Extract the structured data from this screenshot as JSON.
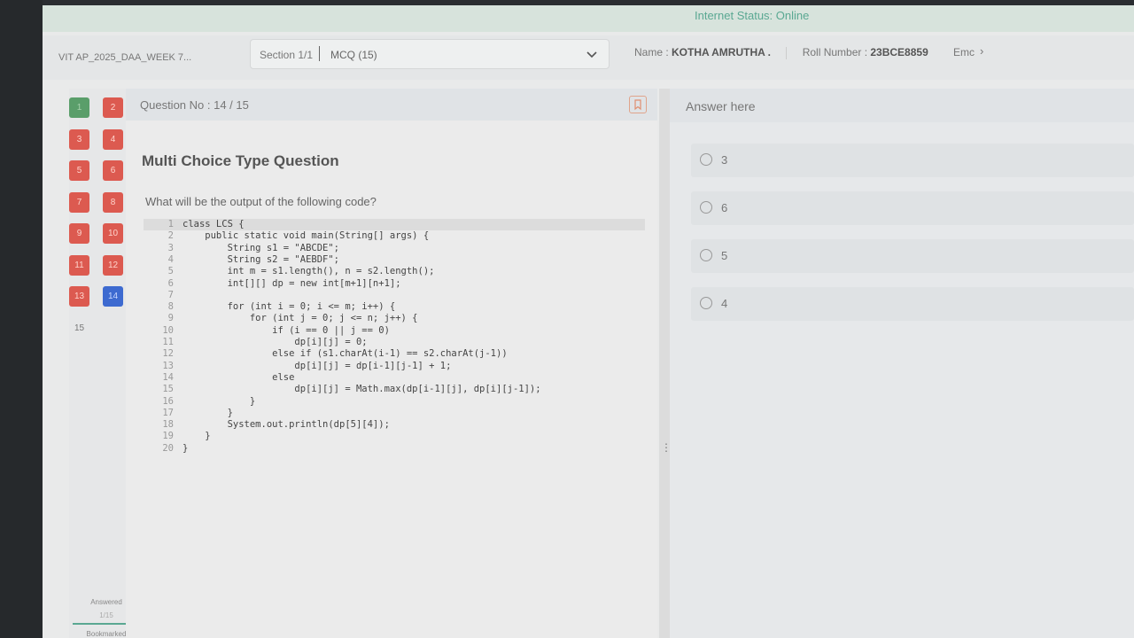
{
  "status": {
    "text": "Internet Status:  Online"
  },
  "header": {
    "exam_title": "VIT AP_2025_DAA_WEEK 7...",
    "section_label": "Section 1/1",
    "section_value": "MCQ (15)",
    "name_label": "Name : ",
    "name_value": "KOTHA AMRUTHA .",
    "roll_label": "Roll Number : ",
    "roll_value": "23BCE8859",
    "email_label": "Emc",
    "scroll_glyph": "›"
  },
  "nav": {
    "questions": [
      {
        "num": "1",
        "state": "answered"
      },
      {
        "num": "2",
        "state": "visited"
      },
      {
        "num": "3",
        "state": "visited"
      },
      {
        "num": "4",
        "state": "visited"
      },
      {
        "num": "5",
        "state": "visited"
      },
      {
        "num": "6",
        "state": "visited"
      },
      {
        "num": "7",
        "state": "visited"
      },
      {
        "num": "8",
        "state": "visited"
      },
      {
        "num": "9",
        "state": "visited"
      },
      {
        "num": "10",
        "state": "visited"
      },
      {
        "num": "11",
        "state": "visited"
      },
      {
        "num": "12",
        "state": "visited"
      },
      {
        "num": "13",
        "state": "visited"
      },
      {
        "num": "14",
        "state": "current"
      },
      {
        "num": "15",
        "state": "unvisited"
      }
    ],
    "answered_label": "Answered",
    "answered_count": "1/15",
    "bookmarked_label": "Bookmarked"
  },
  "question": {
    "number_text": "Question No : 14 / 15",
    "type": "Multi Choice Type Question",
    "text": "What will be the output of the following code?",
    "code": [
      {
        "n": "1",
        "t": "class LCS {"
      },
      {
        "n": "2",
        "t": "    public static void main(String[] args) {"
      },
      {
        "n": "3",
        "t": "        String s1 = \"ABCDE\";"
      },
      {
        "n": "4",
        "t": "        String s2 = \"AEBDF\";"
      },
      {
        "n": "5",
        "t": "        int m = s1.length(), n = s2.length();"
      },
      {
        "n": "6",
        "t": "        int[][] dp = new int[m+1][n+1];"
      },
      {
        "n": "7",
        "t": ""
      },
      {
        "n": "8",
        "t": "        for (int i = 0; i <= m; i++) {"
      },
      {
        "n": "9",
        "t": "            for (int j = 0; j <= n; j++) {"
      },
      {
        "n": "10",
        "t": "                if (i == 0 || j == 0)"
      },
      {
        "n": "11",
        "t": "                    dp[i][j] = 0;"
      },
      {
        "n": "12",
        "t": "                else if (s1.charAt(i-1) == s2.charAt(j-1))"
      },
      {
        "n": "13",
        "t": "                    dp[i][j] = dp[i-1][j-1] + 1;"
      },
      {
        "n": "14",
        "t": "                else"
      },
      {
        "n": "15",
        "t": "                    dp[i][j] = Math.max(dp[i-1][j], dp[i][j-1]);"
      },
      {
        "n": "16",
        "t": "            }"
      },
      {
        "n": "17",
        "t": "        }"
      },
      {
        "n": "18",
        "t": "        System.out.println(dp[5][4]);"
      },
      {
        "n": "19",
        "t": "    }"
      },
      {
        "n": "20",
        "t": "}"
      }
    ]
  },
  "answer": {
    "title": "Answer here",
    "options": [
      {
        "label": "3"
      },
      {
        "label": "6"
      },
      {
        "label": "5"
      },
      {
        "label": "4"
      }
    ]
  }
}
